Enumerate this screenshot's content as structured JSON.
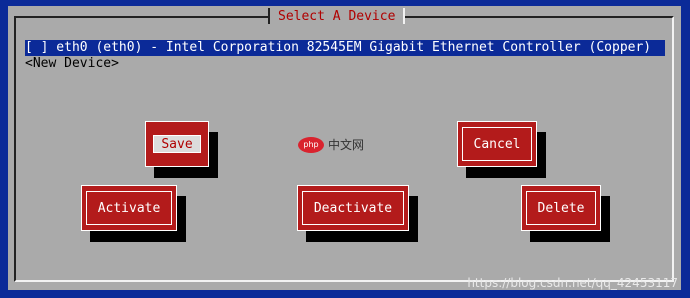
{
  "dialog": {
    "title": "Select A Device"
  },
  "devices": [
    {
      "label": "[ ] eth0 (eth0) - Intel Corporation 82545EM Gigabit Ethernet Controller (Copper)",
      "selected": true
    },
    {
      "label": "<New Device>",
      "selected": false
    }
  ],
  "buttons": {
    "save": "Save",
    "cancel": "Cancel",
    "activate": "Activate",
    "deactivate": "Deactivate",
    "delete": "Delete"
  },
  "watermark": {
    "logo": "php",
    "text": "中文网",
    "url": "https://blog.csdn.net/qq_42453117"
  },
  "colors": {
    "background": "#0b2a98",
    "dialog": "#aaaaaa",
    "button": "#b31b1b",
    "title": "#b00000"
  }
}
